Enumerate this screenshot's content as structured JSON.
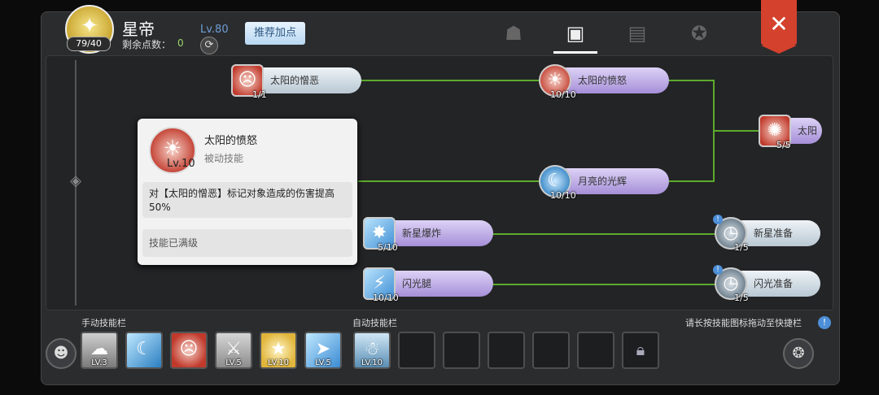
{
  "header": {
    "char_name": "星帝",
    "level": "Lv.80",
    "points_badge": "79/40",
    "remain_label": "剩余点数：",
    "remain_value": "0",
    "recommend_button": "推荐加点",
    "tabs": [
      {
        "icon": "person-star-icon"
      },
      {
        "icon": "contact-book-icon",
        "active": true
      },
      {
        "icon": "book-icon"
      },
      {
        "icon": "winged-star-icon"
      }
    ],
    "close_label": "✕"
  },
  "tree": {
    "nodes": [
      {
        "name": "太阳的憎恶",
        "count": "1/1",
        "icon": "sun-face-icon"
      },
      {
        "name": "太阳的愤怒",
        "count": "10/10",
        "icon": "sun-rays-icon"
      },
      {
        "name": "太阳",
        "count": "5/5",
        "icon": "sun-figure-icon"
      },
      {
        "name": "月亮的光辉",
        "count": "10/10",
        "icon": "moon-wave-icon"
      },
      {
        "name": "新星爆炸",
        "count": "5/10",
        "icon": "nova-burst-icon"
      },
      {
        "name": "新星准备",
        "count": "1/5",
        "icon": "clock-star-icon"
      },
      {
        "name": "闪光腿",
        "count": "10/10",
        "icon": "flash-kick-icon"
      },
      {
        "name": "闪光准备",
        "count": "1/5",
        "icon": "clock-flash-icon"
      }
    ]
  },
  "tooltip": {
    "name": "太阳的愤怒",
    "level": "Lv.10",
    "type": "被动技能",
    "description": "对【太阳的憎恶】标记对象造成的伤害提高50%",
    "status": "技能已满级"
  },
  "bottom": {
    "manual_label": "手动技能栏",
    "auto_label": "自动技能栏",
    "hint": "请长按技能图标拖动至快捷栏",
    "manual_slots": [
      {
        "lv": "LV.3",
        "icon": "smoke-icon"
      },
      {
        "lv": "",
        "icon": "moon-wave-icon"
      },
      {
        "lv": "",
        "icon": "sun-face-icon"
      },
      {
        "lv": "LV.5",
        "icon": "dash-figure-icon"
      },
      {
        "lv": "LV.10",
        "icon": "star-burst-icon"
      },
      {
        "lv": "LV.5",
        "icon": "runner-icon"
      }
    ],
    "auto_slots": [
      {
        "lv": "LV.10",
        "icon": "spirit-figure-icon"
      },
      {
        "lv": "",
        "icon": ""
      },
      {
        "lv": "",
        "icon": ""
      },
      {
        "lv": "",
        "icon": ""
      },
      {
        "lv": "",
        "icon": ""
      },
      {
        "lv": "",
        "icon": ""
      },
      {
        "lv": "",
        "icon": "lock-icon"
      }
    ]
  }
}
